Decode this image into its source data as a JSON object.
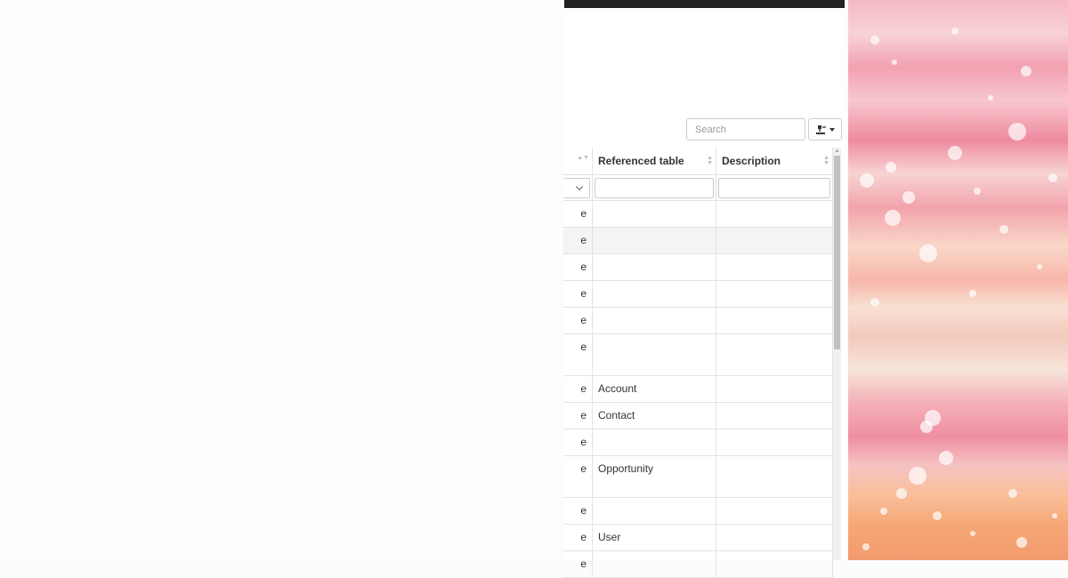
{
  "toolbar": {
    "search_placeholder": "Search",
    "export_icon": "export-icon"
  },
  "table": {
    "columns": [
      "",
      "Referenced table",
      "Description"
    ],
    "rows": [
      {
        "c1": "e",
        "ref": "",
        "desc": ""
      },
      {
        "c1": "e",
        "ref": "",
        "desc": ""
      },
      {
        "c1": "e",
        "ref": "",
        "desc": ""
      },
      {
        "c1": "e",
        "ref": "",
        "desc": ""
      },
      {
        "c1": "e",
        "ref": "",
        "desc": ""
      },
      {
        "c1": "e",
        "ref": "",
        "desc": ""
      },
      {
        "c1": "e",
        "ref": "Account",
        "desc": ""
      },
      {
        "c1": "e",
        "ref": "Contact",
        "desc": ""
      },
      {
        "c1": "e",
        "ref": "",
        "desc": ""
      },
      {
        "c1": "e",
        "ref": "Opportunity",
        "desc": ""
      },
      {
        "c1": "e",
        "ref": "",
        "desc": ""
      },
      {
        "c1": "e",
        "ref": "User",
        "desc": ""
      },
      {
        "c1": "e",
        "ref": "",
        "desc": ""
      }
    ]
  },
  "colors": {
    "topbar": "#222222",
    "grid_border": "#e2e2e2",
    "highlight_row": "#f4f4f4"
  }
}
